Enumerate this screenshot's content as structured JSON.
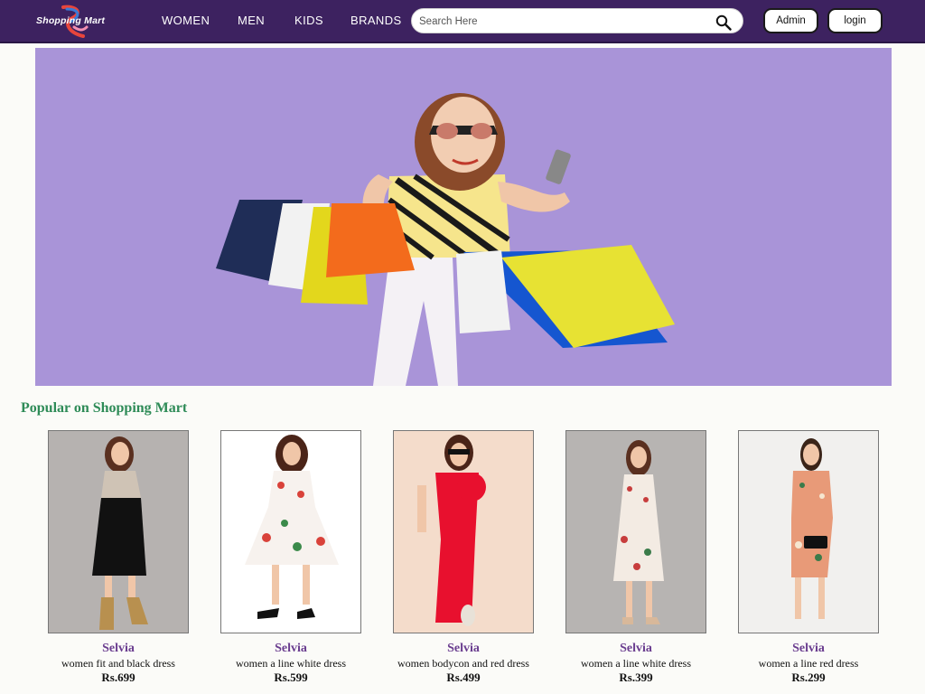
{
  "header": {
    "logo_text": "Shopping Mart",
    "nav": [
      "WOMEN",
      "MEN",
      "KIDS",
      "BRANDS"
    ],
    "search_placeholder": "Search Here",
    "admin_label": "Admin",
    "login_label": "login"
  },
  "colors": {
    "navbar": "#3d2260",
    "hero_bg": "#a994d8",
    "section_title": "#2e8b57",
    "brand_text": "#6a3d8f"
  },
  "main": {
    "section_title": "Popular on Shopping Mart",
    "products": [
      {
        "brand": "Selvia",
        "name": "women fit and black dress",
        "price": "Rs.699"
      },
      {
        "brand": "Selvia",
        "name": "women a line white dress",
        "price": "Rs.599"
      },
      {
        "brand": "Selvia",
        "name": "women bodycon and red dress",
        "price": "Rs.499"
      },
      {
        "brand": "Selvia",
        "name": "women a line white dress",
        "price": "Rs.399"
      },
      {
        "brand": "Selvia",
        "name": "women a line red dress",
        "price": "Rs.299"
      }
    ]
  }
}
